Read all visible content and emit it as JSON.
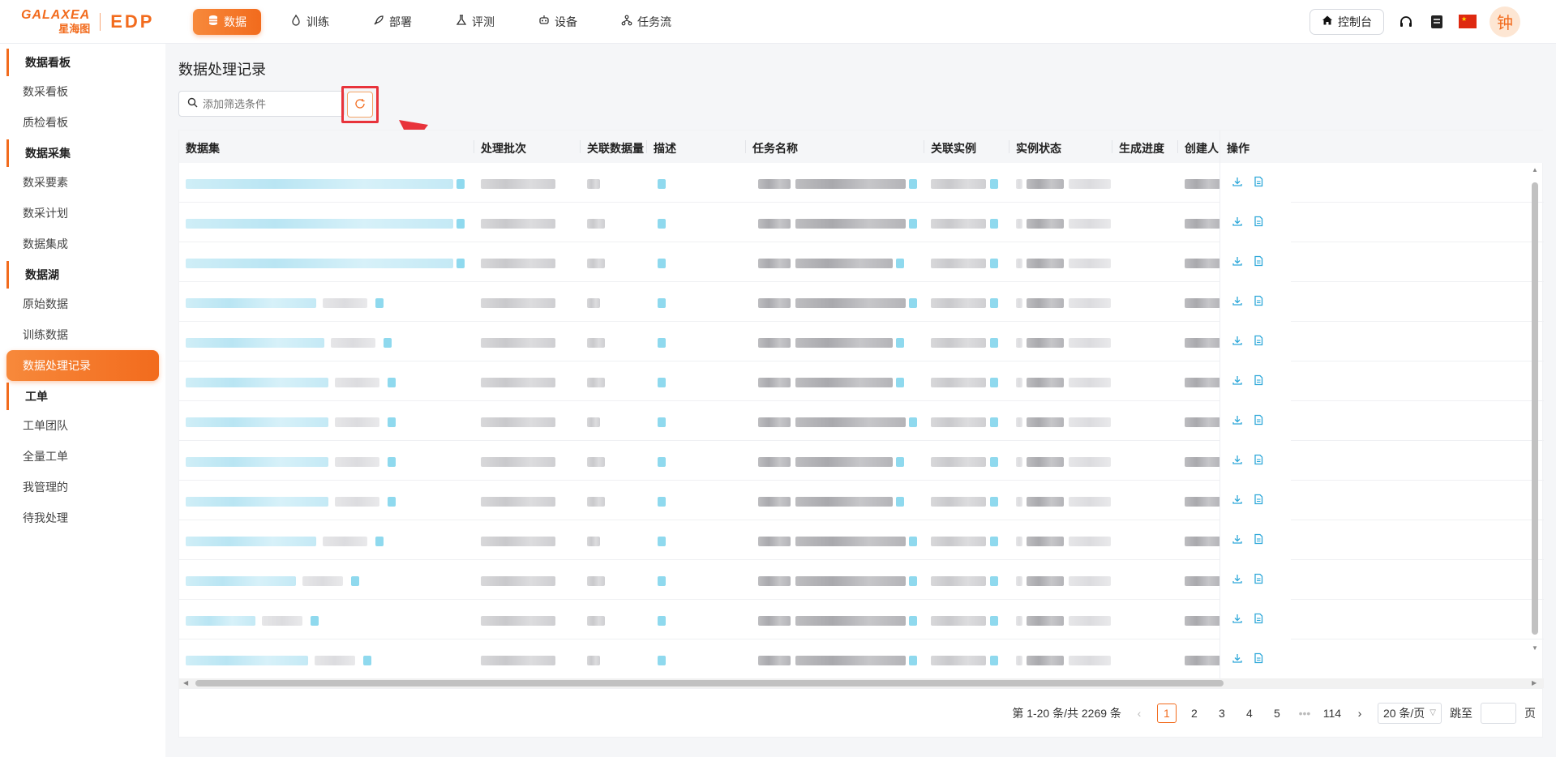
{
  "brand": {
    "name_en": "GALAXEA",
    "name_cn": "星海图",
    "product": "EDP"
  },
  "top_nav": [
    {
      "label": "数据",
      "icon": "database-icon",
      "active": true
    },
    {
      "label": "训练",
      "icon": "flame-icon",
      "active": false
    },
    {
      "label": "部署",
      "icon": "rocket-icon",
      "active": false
    },
    {
      "label": "评测",
      "icon": "flask-icon",
      "active": false
    },
    {
      "label": "设备",
      "icon": "robot-icon",
      "active": false
    },
    {
      "label": "任务流",
      "icon": "workflow-icon",
      "active": false
    }
  ],
  "top_right": {
    "console_label": "控制台",
    "avatar_text": "钟"
  },
  "sidebar": {
    "groups": [
      {
        "title": "数据看板",
        "items": [
          "数采看板",
          "质检看板"
        ]
      },
      {
        "title": "数据采集",
        "items": [
          "数采要素",
          "数采计划",
          "数据集成"
        ]
      },
      {
        "title": "数据湖",
        "items": [
          "原始数据",
          "训练数据",
          "数据处理记录"
        ]
      },
      {
        "title": "工单",
        "items": [
          "工单团队",
          "全量工单",
          "我管理的",
          "待我处理"
        ]
      }
    ],
    "active_item": "数据处理记录"
  },
  "page": {
    "title": "数据处理记录",
    "search_placeholder": "添加筛选条件"
  },
  "table": {
    "columns": [
      "数据集",
      "处理批次",
      "关联数据量",
      "描述",
      "任务名称",
      "关联实例",
      "实例状态",
      "生成进度",
      "创建人",
      "操作"
    ]
  },
  "pagination": {
    "summary": "第 1-20 条/共 2269 条",
    "pages": [
      "1",
      "2",
      "3",
      "4",
      "5",
      "•••",
      "114"
    ],
    "current": "1",
    "page_size": "20 条/页",
    "jump_label": "跳至",
    "page_suffix": "页"
  },
  "colors": {
    "accent": "#f26b1d",
    "highlight_box": "#e8333b"
  }
}
